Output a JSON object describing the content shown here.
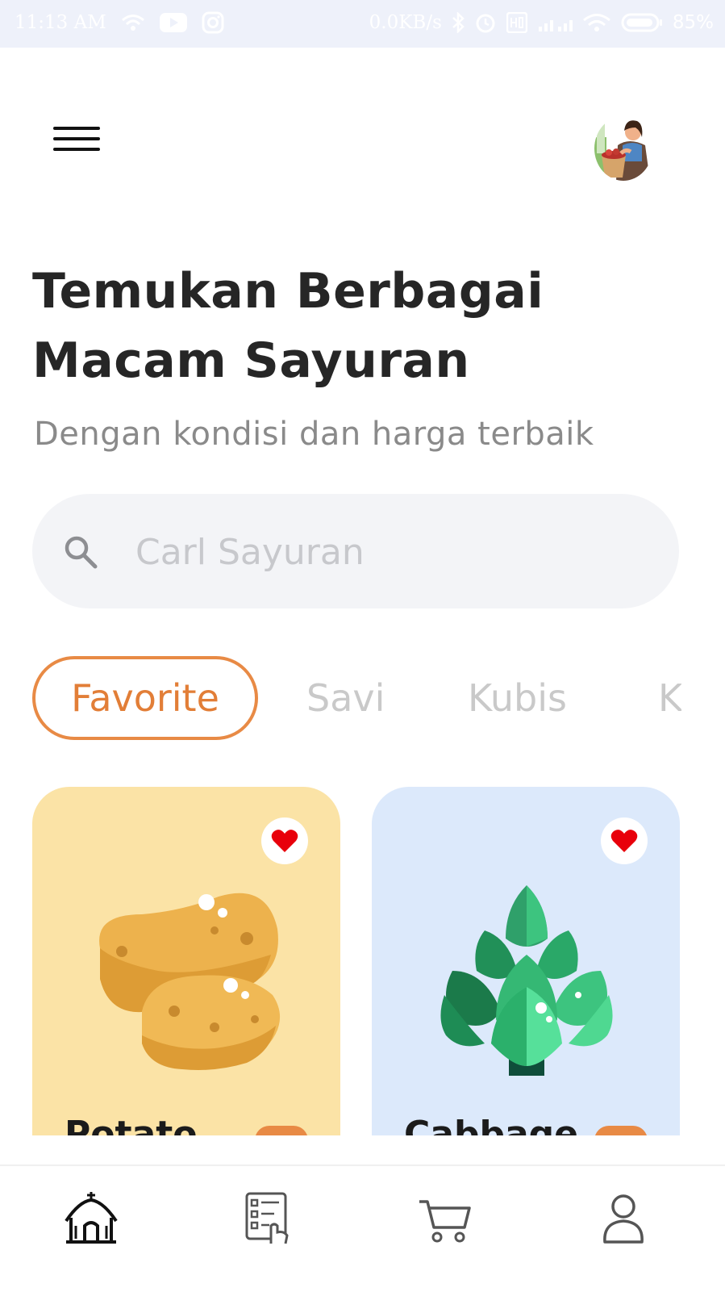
{
  "status_bar": {
    "time": "11:13 AM",
    "network_speed": "0.0KB/s",
    "battery": "85%",
    "icons": [
      "wifi-icon",
      "youtube-icon",
      "instagram-icon",
      "bluetooth-icon",
      "alarm-icon",
      "signal-icon",
      "wifi-icon",
      "battery-icon"
    ]
  },
  "header": {
    "menu_icon": "hamburger-menu-icon",
    "avatar": "user-avatar"
  },
  "headline": {
    "line1": "Temukan Berbagai",
    "line2": "Macam Sayuran",
    "subtitle": "Dengan kondisi dan harga terbaik"
  },
  "search": {
    "placeholder": "Carl Sayuran",
    "icon": "search-icon"
  },
  "tabs": [
    {
      "label": "Favorite",
      "active": true
    },
    {
      "label": "Savi",
      "active": false
    },
    {
      "label": "Kubis",
      "active": false
    },
    {
      "label": "K",
      "active": false
    }
  ],
  "products": [
    {
      "name": "Potato",
      "background": "#fbe3a6",
      "favorite": true,
      "icon": "potato-icon"
    },
    {
      "name": "Cabbage",
      "background": "#dce9fb",
      "favorite": true,
      "icon": "cabbage-icon"
    }
  ],
  "bottom_nav": [
    {
      "icon": "home-icon",
      "active": true
    },
    {
      "icon": "order-list-icon",
      "active": false
    },
    {
      "icon": "cart-icon",
      "active": false
    },
    {
      "icon": "profile-icon",
      "active": false
    }
  ],
  "colors": {
    "accent": "#e88a45",
    "heart": "#e8000b",
    "text": "#262626",
    "muted": "#8a8a8a"
  }
}
